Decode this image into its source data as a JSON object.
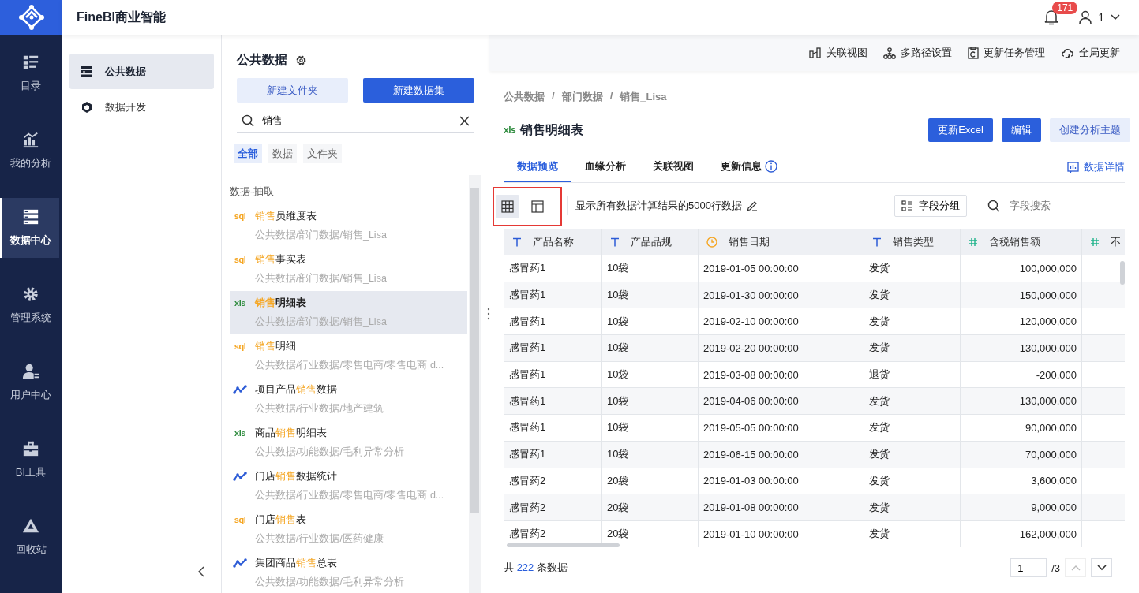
{
  "app": {
    "title": "FineBI商业智能",
    "notifications": "171",
    "user": "1"
  },
  "nav": [
    {
      "label": "目录",
      "selected": false
    },
    {
      "label": "我的分析",
      "selected": false
    },
    {
      "label": "数据中心",
      "selected": true
    },
    {
      "label": "管理系统",
      "selected": false
    },
    {
      "label": "用户中心",
      "selected": false
    },
    {
      "label": "BI工具",
      "selected": false
    },
    {
      "label": "回收站",
      "selected": false
    }
  ],
  "sidebar": [
    {
      "label": "公共数据",
      "selected": true
    },
    {
      "label": "数据开发",
      "selected": false
    }
  ],
  "list_panel": {
    "title": "公共数据",
    "buttons": [
      {
        "label": "新建文件夹",
        "primary": false
      },
      {
        "label": "新建数据集",
        "primary": true
      }
    ],
    "search": {
      "value": "销售"
    },
    "filters": [
      {
        "label": "全部",
        "selected": true
      },
      {
        "label": "数据",
        "selected": false
      },
      {
        "label": "文件夹",
        "selected": false
      }
    ],
    "group": "数据-抽取",
    "items": [
      {
        "kind": "sql",
        "type_label": "sql",
        "name": [
          {
            "text": "销售",
            "match": true
          },
          {
            "text": "员维度表",
            "match": false
          }
        ],
        "path": "公共数据/部门数据/销售_Lisa",
        "selected": false
      },
      {
        "kind": "sql",
        "type_label": "sql",
        "name": [
          {
            "text": "销售",
            "match": true
          },
          {
            "text": "事实表",
            "match": false
          }
        ],
        "path": "公共数据/部门数据/销售_Lisa",
        "selected": false
      },
      {
        "kind": "xls",
        "type_label": "xls",
        "name": [
          {
            "text": "销售",
            "match": true
          },
          {
            "text": "明细表",
            "match": false
          }
        ],
        "path": "公共数据/部门数据/销售_Lisa",
        "selected": true
      },
      {
        "kind": "sql",
        "type_label": "sql",
        "name": [
          {
            "text": "销售",
            "match": true
          },
          {
            "text": "明细",
            "match": false
          }
        ],
        "path": "公共数据/行业数据/零售电商/零售电商 d...",
        "selected": false
      },
      {
        "kind": "chart",
        "name": [
          {
            "text": "项目产品",
            "match": false
          },
          {
            "text": "销售",
            "match": true
          },
          {
            "text": "数据",
            "match": false
          }
        ],
        "path": "公共数据/行业数据/地产建筑",
        "selected": false
      },
      {
        "kind": "xls",
        "type_label": "xls",
        "name": [
          {
            "text": "商品",
            "match": false
          },
          {
            "text": "销售",
            "match": true
          },
          {
            "text": "明细表",
            "match": false
          }
        ],
        "path": "公共数据/功能数据/毛利异常分析",
        "selected": false
      },
      {
        "kind": "chart",
        "name": [
          {
            "text": "门店",
            "match": false
          },
          {
            "text": "销售",
            "match": true
          },
          {
            "text": "数据统计",
            "match": false
          }
        ],
        "path": "公共数据/行业数据/零售电商/零售电商 d...",
        "selected": false
      },
      {
        "kind": "sql",
        "type_label": "sql",
        "name": [
          {
            "text": "门店",
            "match": false
          },
          {
            "text": "销售",
            "match": true
          },
          {
            "text": "表",
            "match": false
          }
        ],
        "path": "公共数据/行业数据/医药健康",
        "selected": false
      },
      {
        "kind": "chart",
        "name": [
          {
            "text": "集团商品",
            "match": false
          },
          {
            "text": "销售",
            "match": true
          },
          {
            "text": "总表",
            "match": false
          }
        ],
        "path": "公共数据/功能数据/毛利异常分析",
        "selected": false
      }
    ]
  },
  "toolbar": [
    "关联视图",
    "多路径设置",
    "更新任务管理",
    "全局更新"
  ],
  "breadcrumb": [
    "公共数据",
    "部门数据",
    "销售_Lisa"
  ],
  "breadcrumb_separator": "/",
  "dataset": {
    "type_label": "xls",
    "title": "销售明细表",
    "actions": [
      {
        "label": "更新Excel",
        "primary": true
      },
      {
        "label": "编辑",
        "primary": true
      },
      {
        "label": "创建分析主题",
        "primary": false
      }
    ]
  },
  "tabs": [
    {
      "label": "数据预览",
      "selected": true,
      "info": false
    },
    {
      "label": "血缘分析",
      "selected": false,
      "info": false
    },
    {
      "label": "关联视图",
      "selected": false,
      "info": false
    },
    {
      "label": "更新信息",
      "selected": false,
      "info": true
    }
  ],
  "details_link": "数据详情",
  "preview": {
    "annotated": true,
    "view_modes": [
      {
        "kind": "grid",
        "selected": true
      },
      {
        "kind": "layout",
        "selected": false
      }
    ],
    "note": "显示所有数据计算结果的5000行数据",
    "group_button": "字段分组",
    "field_search": {
      "placeholder": "字段搜索"
    }
  },
  "table": {
    "columns": [
      {
        "kind": "text",
        "name": "产品名称"
      },
      {
        "kind": "text",
        "name": "产品品规"
      },
      {
        "kind": "date",
        "name": "销售日期"
      },
      {
        "kind": "text",
        "name": "销售类型"
      },
      {
        "kind": "number",
        "name": "含税销售额"
      },
      {
        "kind": "number",
        "name": "不"
      }
    ],
    "rows": [
      [
        "感冒药1",
        "10袋",
        "2019-01-05 00:00:00",
        "发货",
        "100,000,000"
      ],
      [
        "感冒药1",
        "10袋",
        "2019-01-30 00:00:00",
        "发货",
        "150,000,000"
      ],
      [
        "感冒药1",
        "10袋",
        "2019-02-10 00:00:00",
        "发货",
        "120,000,000"
      ],
      [
        "感冒药1",
        "10袋",
        "2019-02-20 00:00:00",
        "发货",
        "130,000,000"
      ],
      [
        "感冒药1",
        "10袋",
        "2019-03-08 00:00:00",
        "退货",
        "-200,000"
      ],
      [
        "感冒药1",
        "10袋",
        "2019-04-06 00:00:00",
        "发货",
        "130,000,000"
      ],
      [
        "感冒药1",
        "10袋",
        "2019-05-05 00:00:00",
        "发货",
        "90,000,000"
      ],
      [
        "感冒药1",
        "10袋",
        "2019-06-15 00:00:00",
        "发货",
        "70,000,000"
      ],
      [
        "感冒药2",
        "20袋",
        "2019-01-03 00:00:00",
        "发货",
        "3,600,000"
      ],
      [
        "感冒药2",
        "20袋",
        "2019-01-08 00:00:00",
        "发货",
        "9,000,000"
      ],
      [
        "感冒药2",
        "20袋",
        "2019-01-10 00:00:00",
        "发货",
        "162,000,000"
      ]
    ]
  },
  "footer": {
    "prefix": "共",
    "count": "222",
    "suffix": "条数据",
    "page": "1",
    "pages": "/3"
  }
}
